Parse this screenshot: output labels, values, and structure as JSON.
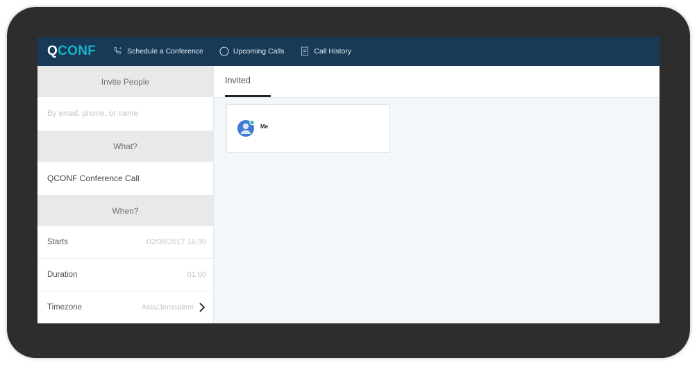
{
  "app": {
    "logo_q": "Q",
    "logo_rest": "CONF",
    "accent_color": "#16b5c9",
    "nav_bg_color": "#183a57"
  },
  "nav": {
    "items": [
      {
        "label": "Schedule a Conference",
        "icon": "phone-plus-icon"
      },
      {
        "label": "Upcoming Calls",
        "icon": "clock-icon"
      },
      {
        "label": "Call History",
        "icon": "document-icon"
      }
    ]
  },
  "sidebar": {
    "invite_header": "Invite People",
    "invite_placeholder": "By email, phone, or name",
    "what_header": "What?",
    "conference_name": "QCONF Conference Call",
    "when_header": "When?",
    "starts_label": "Starts",
    "starts_value": "02/08/2017 16:30",
    "duration_label": "Duration",
    "duration_value": "01:00",
    "timezone_label": "Timezone",
    "timezone_value": "Asia/Jerusalem"
  },
  "main": {
    "tab_label": "Invited",
    "participants": [
      {
        "name": "Me",
        "icon": "user-avatar-icon"
      }
    ]
  }
}
